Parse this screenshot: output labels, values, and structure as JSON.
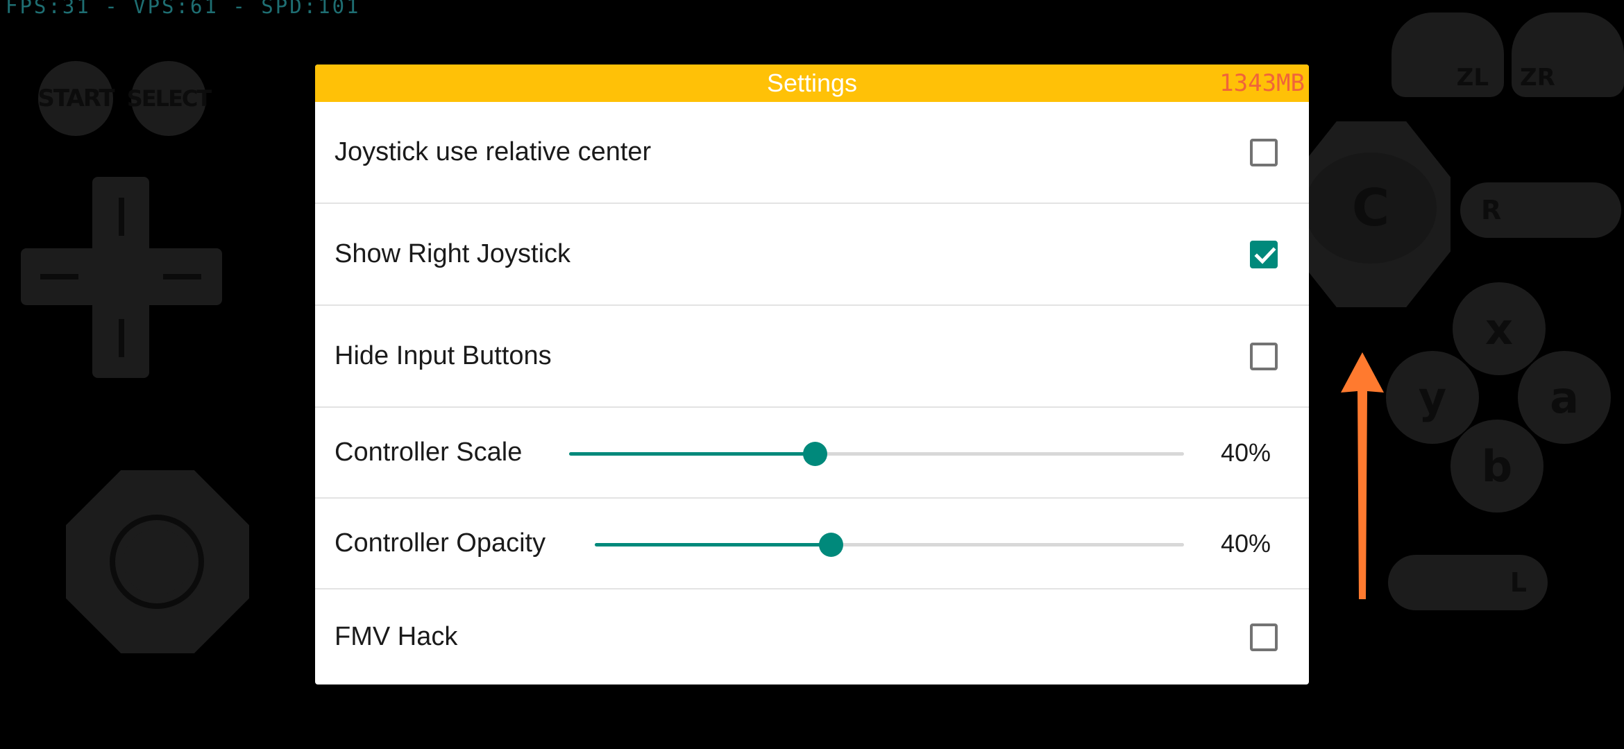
{
  "stats_text": "FPS:31 - VPS:61 - SPD:101",
  "controller": {
    "start_label": "START",
    "select_label": "SELECT",
    "c_label": "C",
    "zl_label": "ZL",
    "zr_label": "ZR",
    "r_label": "R",
    "l_label": "L",
    "x_label": "x",
    "y_label": "y",
    "a_label": "a",
    "b_label": "b"
  },
  "dialog": {
    "title": "Settings",
    "memory": "1343MB",
    "rows": [
      {
        "label": "Joystick use relative center",
        "type": "checkbox",
        "checked": false
      },
      {
        "label": "Show Right Joystick",
        "type": "checkbox",
        "checked": true
      },
      {
        "label": "Hide Input Buttons",
        "type": "checkbox",
        "checked": false
      },
      {
        "label": "Controller Scale",
        "type": "slider",
        "value": 0.4,
        "value_text": "40%"
      },
      {
        "label": "Controller Opacity",
        "type": "slider",
        "value": 0.4,
        "value_text": "40%"
      },
      {
        "label": "FMV Hack",
        "type": "checkbox",
        "checked": false
      }
    ]
  },
  "colors": {
    "title_bar": "#ffc107",
    "accent": "#00897b",
    "memory_text": "#f0643a",
    "arrow": "#ff7a2f"
  }
}
